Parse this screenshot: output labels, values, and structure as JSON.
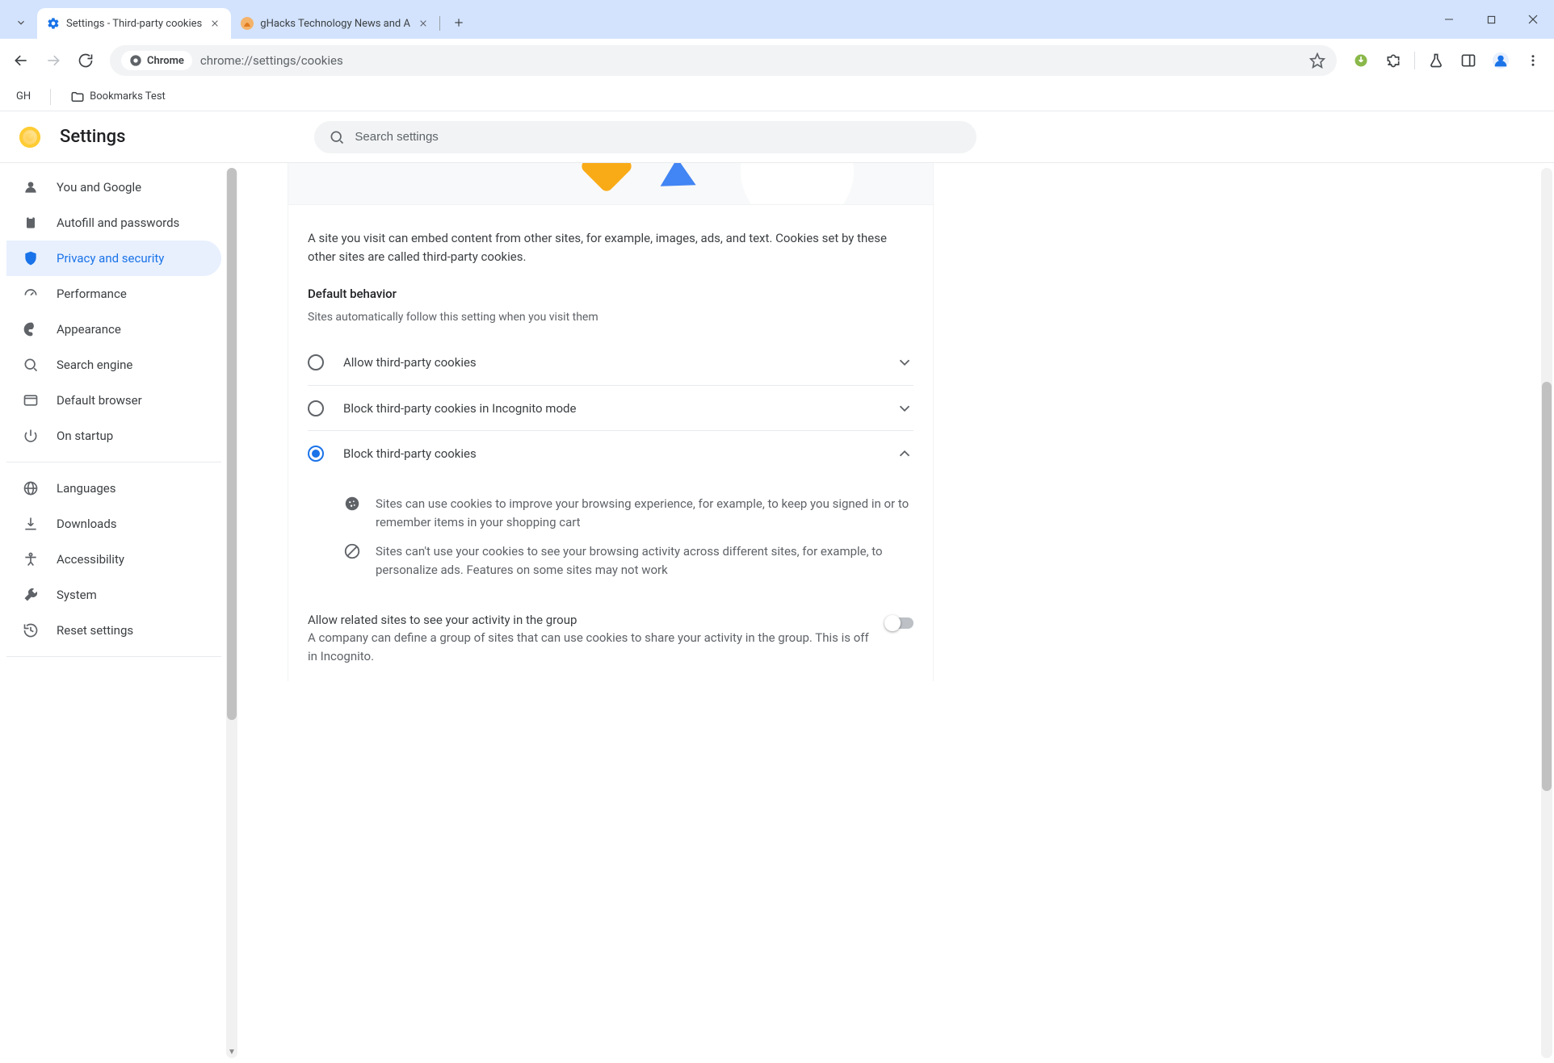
{
  "tabs": {
    "active": {
      "title": "Settings - Third-party cookies"
    },
    "inactive": {
      "title": "gHacks Technology News and A"
    }
  },
  "omnibox": {
    "chip_label": "Chrome",
    "url": "chrome://settings/cookies"
  },
  "bookmarks": {
    "item1": "GH",
    "item2": "Bookmarks Test"
  },
  "app": {
    "title": "Settings",
    "search_placeholder": "Search settings"
  },
  "sidebar": {
    "items": [
      {
        "label": "You and Google"
      },
      {
        "label": "Autofill and passwords"
      },
      {
        "label": "Privacy and security"
      },
      {
        "label": "Performance"
      },
      {
        "label": "Appearance"
      },
      {
        "label": "Search engine"
      },
      {
        "label": "Default browser"
      },
      {
        "label": "On startup"
      },
      {
        "label": "Languages"
      },
      {
        "label": "Downloads"
      },
      {
        "label": "Accessibility"
      },
      {
        "label": "System"
      },
      {
        "label": "Reset settings"
      }
    ]
  },
  "main": {
    "intro": "A site you visit can embed content from other sites, for example, images, ads, and text. Cookies set by these other sites are called third-party cookies.",
    "section_title": "Default behavior",
    "section_sub": "Sites automatically follow this setting when you visit them",
    "options": {
      "allow": "Allow third-party cookies",
      "incognito": "Block third-party cookies in Incognito mode",
      "block": "Block third-party cookies"
    },
    "details": {
      "line1": "Sites can use cookies to improve your browsing experience, for example, to keep you signed in or to remember items in your shopping cart",
      "line2": "Sites can't use your cookies to see your browsing activity across different sites, for example, to personalize ads. Features on some sites may not work"
    },
    "related": {
      "title": "Allow related sites to see your activity in the group",
      "sub": "A company can define a group of sites that can use cookies to share your activity in the group. This is off in Incognito."
    }
  }
}
